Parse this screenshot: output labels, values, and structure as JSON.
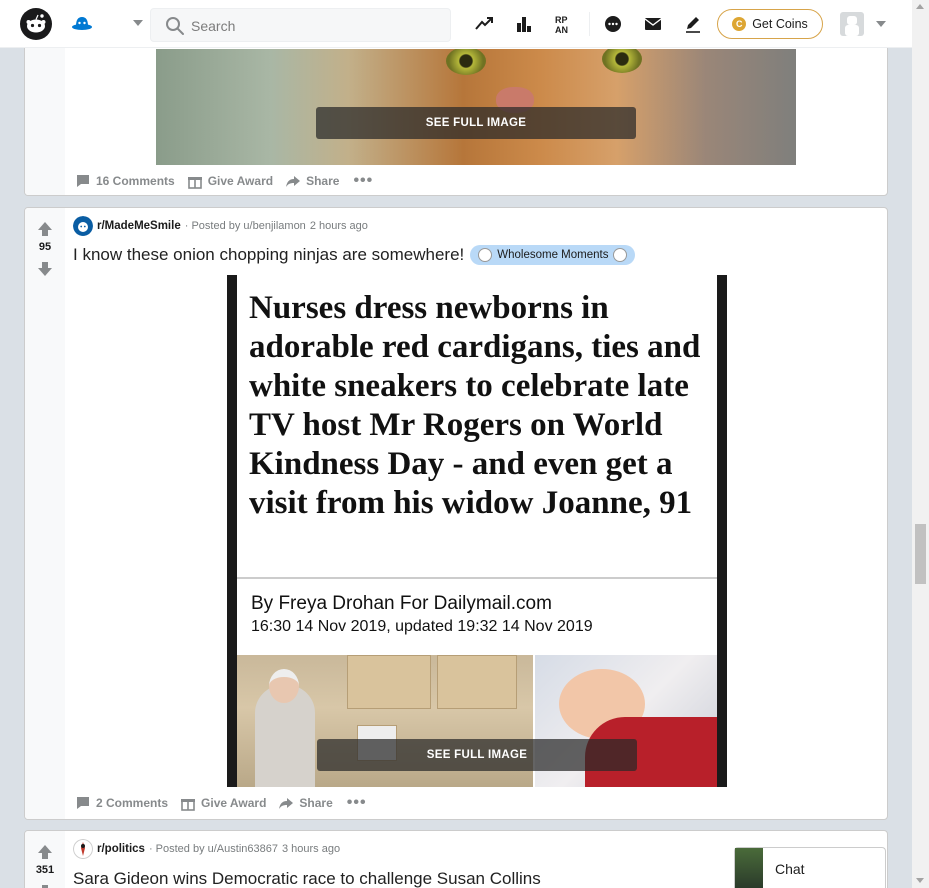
{
  "header": {
    "search_placeholder": "Search",
    "get_coins_label": "Get Coins",
    "coin_symbol": "C",
    "icons": [
      "trending-icon",
      "leaderboard-icon",
      "rpan-icon",
      "chat-icon",
      "mail-icon",
      "create-post-icon"
    ]
  },
  "post_top": {
    "image_button": "SEE FULL IMAGE",
    "comments": "16 Comments",
    "give_award": "Give Award",
    "share": "Share",
    "more": "•••"
  },
  "post_main": {
    "votes": "95",
    "subreddit": "r/MadeMeSmile",
    "posted_by": "· Posted by u/benjilamon",
    "time": "2 hours ago",
    "title": "I know these onion chopping ninjas are somewhere!",
    "flair": "Wholesome Moments",
    "article": {
      "headline": "Nurses dress newborns in adorable red cardigans, ties and white sneakers to celebrate late TV host Mr Rogers on World Kindness Day - and even get a visit from his widow Joanne, 91",
      "byline": "By Freya Drohan For Dailymail.com",
      "date": "16:30 14 Nov 2019, updated 19:32 14 Nov 2019"
    },
    "image_button": "SEE FULL IMAGE",
    "comments": "2 Comments",
    "give_award": "Give Award",
    "share": "Share",
    "more": "•••"
  },
  "post_bottom": {
    "votes": "351",
    "subreddit": "r/politics",
    "posted_by": "· Posted by u/Austin63867",
    "time": "3 hours ago",
    "title": "Sara Gideon wins Democratic race to challenge Susan Collins"
  },
  "chat": {
    "label": "Chat"
  },
  "colors": {
    "accent": "#0079d3",
    "coin_border": "#d7a44a",
    "flair_bg": "#b9d9f7",
    "page_bg": "#dae0e6"
  }
}
